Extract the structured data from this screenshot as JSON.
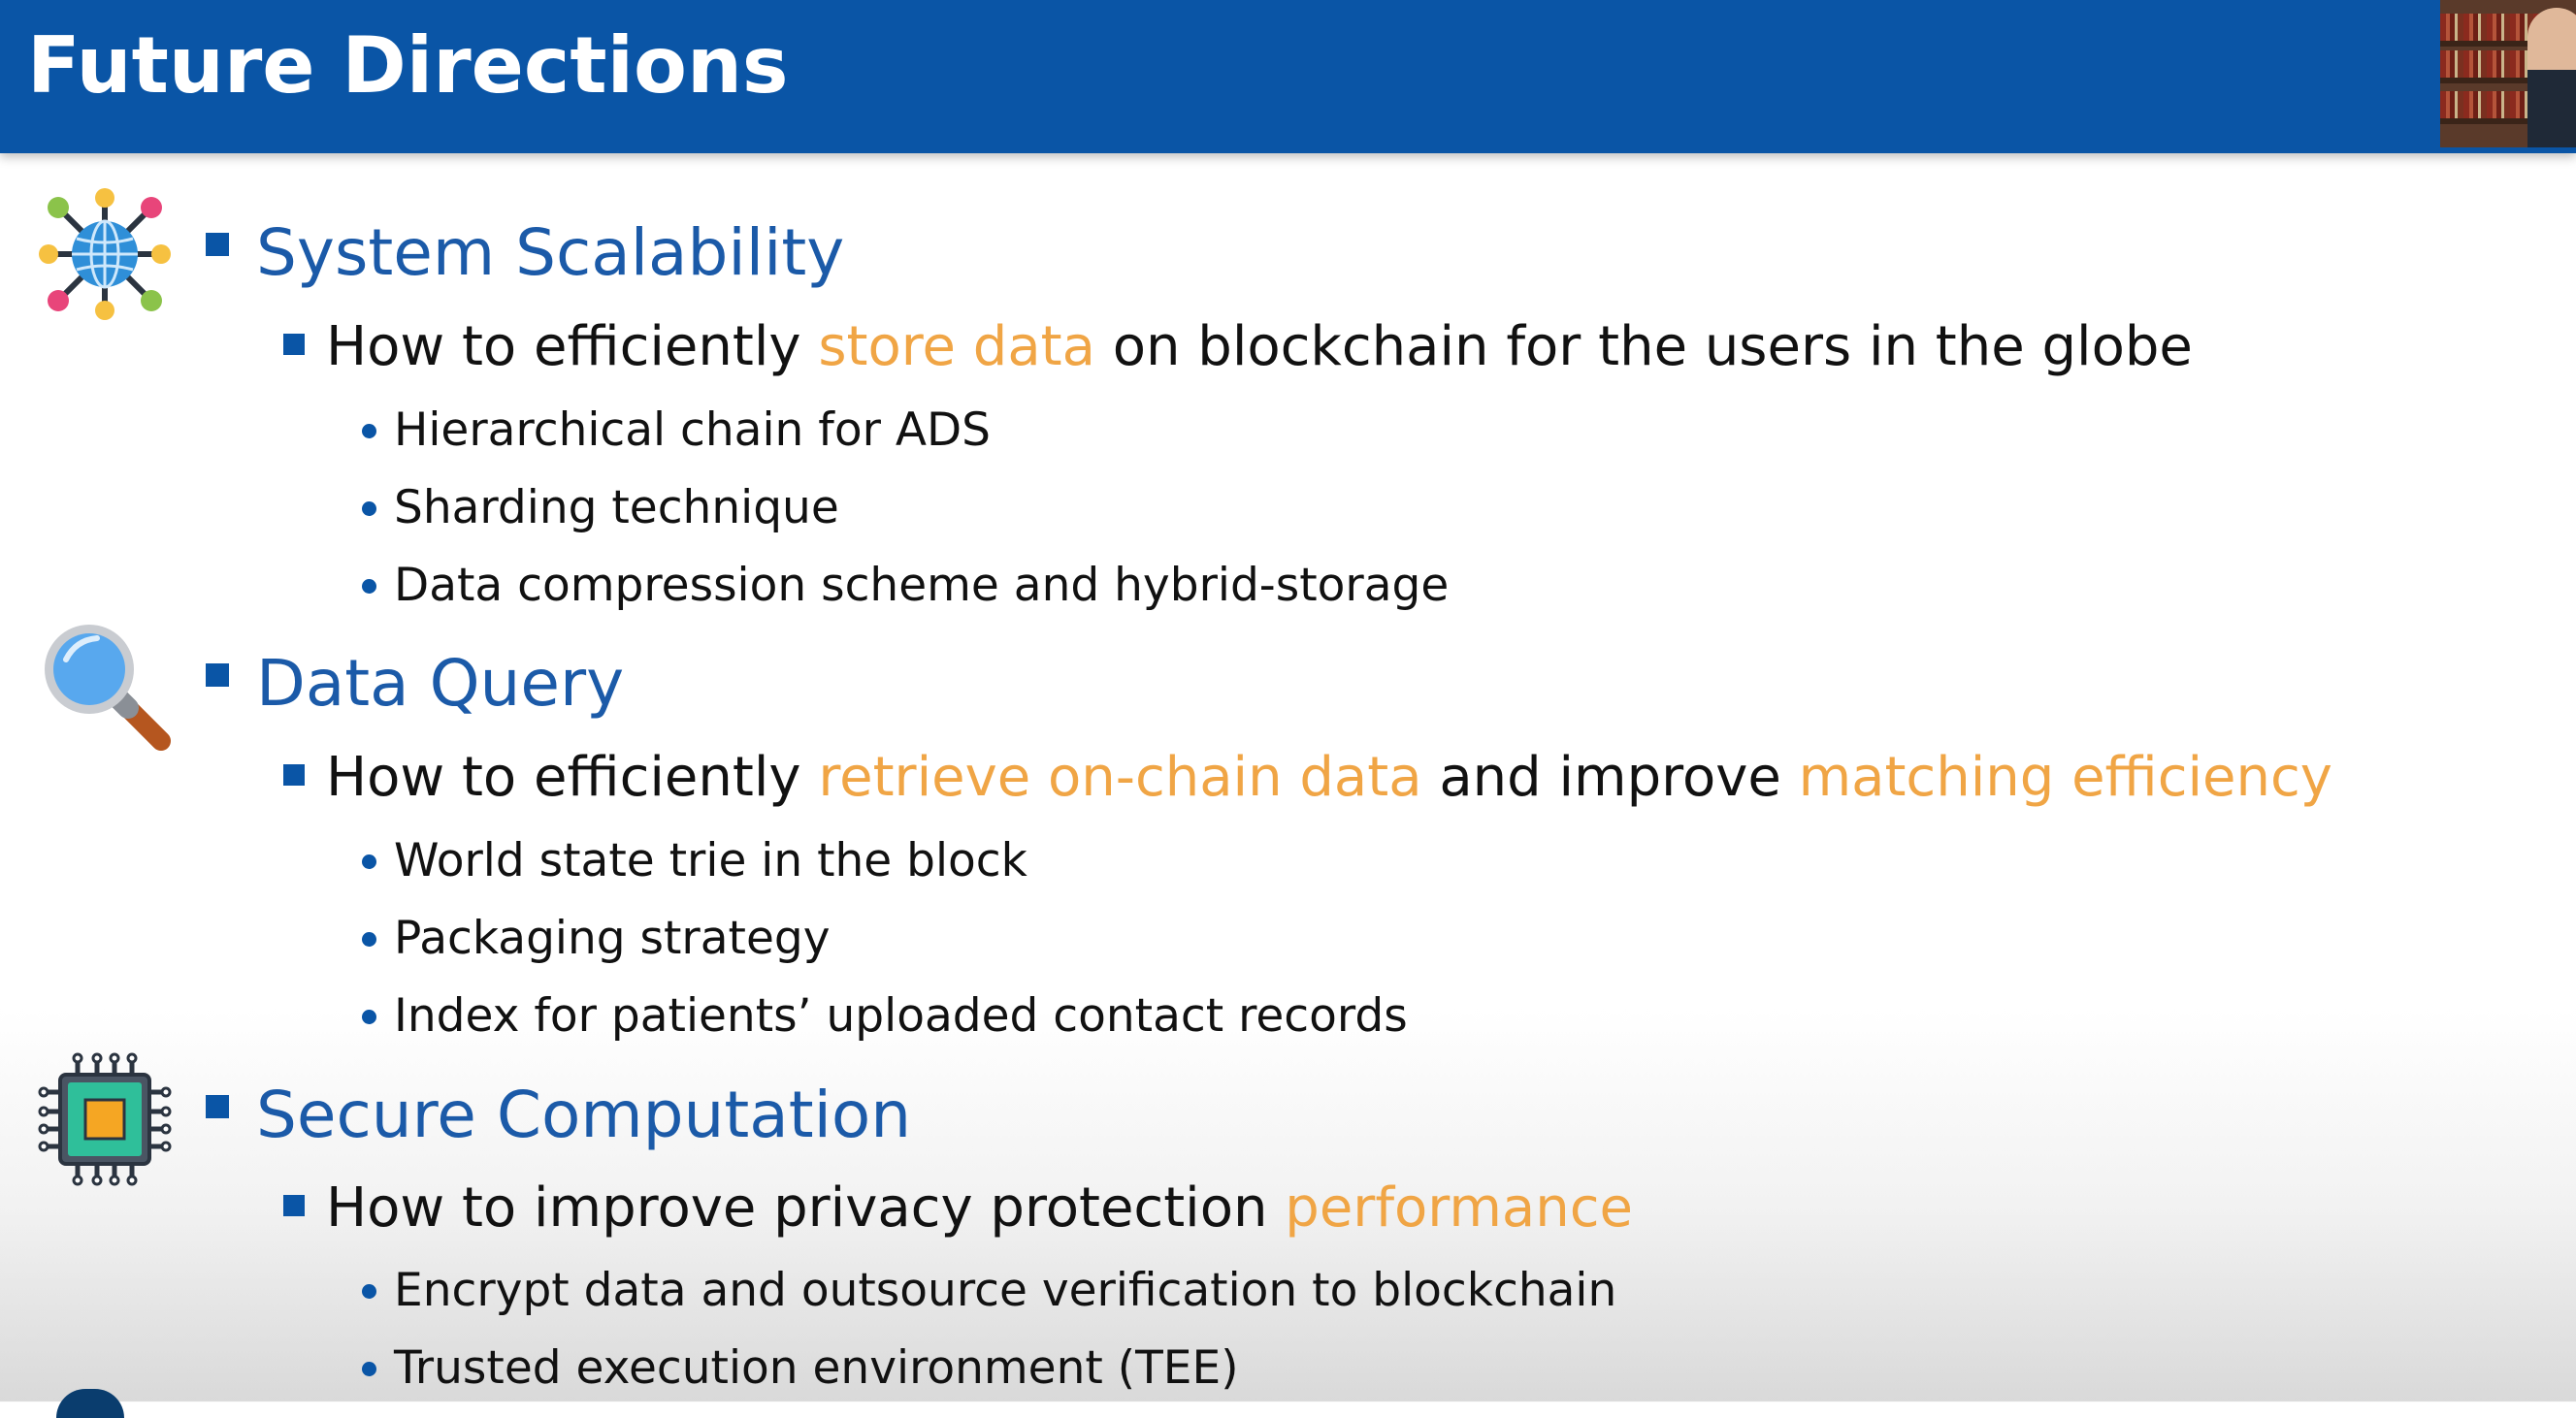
{
  "slide": {
    "title": "Future Directions",
    "accent_color": "#0a55a6",
    "highlight_color": "#f0a545"
  },
  "sections": [
    {
      "icon": "network-globe-icon",
      "heading": "System Scalability",
      "question": {
        "before": "How to efficiently ",
        "hl1": "store data",
        "middle": " on blockchain for the users in the globe"
      },
      "points": [
        "Hierarchical chain for ADS",
        "Sharding technique",
        "Data compression scheme and hybrid-storage"
      ]
    },
    {
      "icon": "magnifying-glass-icon",
      "heading": "Data Query",
      "question": {
        "before": "How to efficiently ",
        "hl1": "retrieve on-chain data",
        "middle": " and improve ",
        "hl2": "matching efficiency"
      },
      "points": [
        "World state trie in the block",
        "Packaging strategy",
        "Index for patients’ uploaded contact records"
      ]
    },
    {
      "icon": "cpu-chip-icon",
      "heading": "Secure Computation",
      "question": {
        "before": "How to improve privacy protection ",
        "hl1": "performance"
      },
      "points": [
        "Encrypt data and outsource verification to blockchain",
        "Trusted execution environment (TEE)"
      ]
    }
  ]
}
